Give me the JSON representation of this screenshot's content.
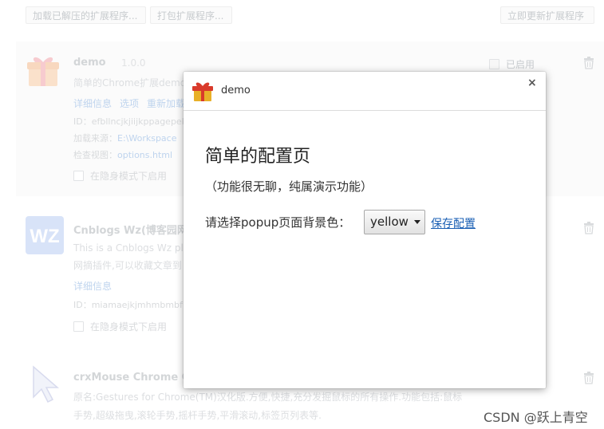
{
  "toolbar": {
    "load_unpacked": "加载已解压的扩展程序...",
    "pack": "打包扩展程序...",
    "update_now": "立即更新扩展程序"
  },
  "extensions": [
    {
      "name": "demo",
      "version": "1.0.0",
      "desc": "简单的Chrome扩展demo",
      "links": [
        "详细信息",
        "选项",
        "重新加载"
      ],
      "id_label": "ID：",
      "id_value": "efbllncjkjiijkppagepek",
      "source_label": "加载来源：",
      "source_value": "E:\\Workspace",
      "inspect_label": "检查视图：",
      "inspect_value": "options.html",
      "incognito": "在隐身模式下启用",
      "enabled_label": "已启用"
    },
    {
      "name": "Cnblogs Wz(博客园网",
      "desc1": "This is a Cnblogs Wz plu",
      "desc2": "网摘插件,可以收藏文章到",
      "links": [
        "详细信息"
      ],
      "id_label": "ID：",
      "id_value": "miamaejkjmhmbmbf",
      "incognito": "在隐身模式下启用"
    },
    {
      "name": "crxMouse Chrome Ge",
      "desc1": "原名:Gestures for Chrome(TM)汉化版.方便,快捷,充分发掘鼠标的所有操作.功能包括:鼠标",
      "desc2": "手势,超级拖曳,滚轮手势,摇杆手势,平滑滚动,标签页列表等."
    }
  ],
  "dialog": {
    "title": "demo",
    "close": "×",
    "heading": "简单的配置页",
    "subheading": "（功能很无聊，纯属演示功能）",
    "prompt": "请选择popup页面背景色：",
    "select_value": "yellow",
    "save_label": "保存配置"
  },
  "watermark": "CSDN @跃上青空",
  "icons": [
    "gift-icon",
    "wz-logo-icon",
    "cursor-icon",
    "trash-icon",
    "close-icon",
    "checkbox-icon"
  ],
  "colors": {
    "link": "#1a5fb4",
    "muted_link": "#8ab1e0",
    "card_bg": "#f7f7f7"
  }
}
